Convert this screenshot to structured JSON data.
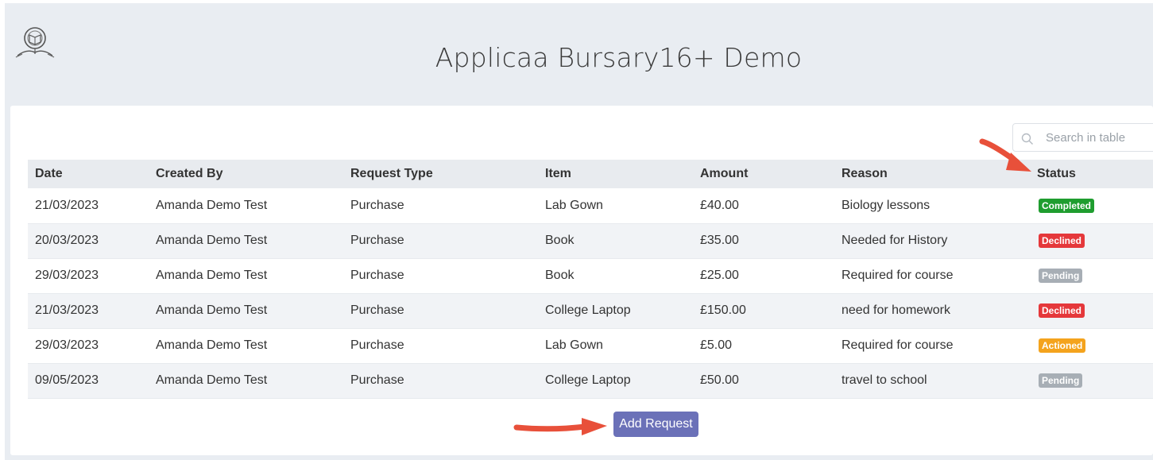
{
  "app": {
    "title": "Applicaa Bursary16+ Demo"
  },
  "search": {
    "placeholder": "Search in table"
  },
  "table": {
    "columns": [
      "Date",
      "Created By",
      "Request Type",
      "Item",
      "Amount",
      "Reason",
      "Status"
    ],
    "rows": [
      {
        "date": "21/03/2023",
        "created_by": "Amanda Demo Test",
        "request_type": "Purchase",
        "item": "Lab Gown",
        "amount": "£40.00",
        "reason": "Biology lessons",
        "status": "Completed"
      },
      {
        "date": "20/03/2023",
        "created_by": "Amanda Demo Test",
        "request_type": "Purchase",
        "item": "Book",
        "amount": "£35.00",
        "reason": "Needed for History",
        "status": "Declined"
      },
      {
        "date": "29/03/2023",
        "created_by": "Amanda Demo Test",
        "request_type": "Purchase",
        "item": "Book",
        "amount": "£25.00",
        "reason": "Required for course",
        "status": "Pending"
      },
      {
        "date": "21/03/2023",
        "created_by": "Amanda Demo Test",
        "request_type": "Purchase",
        "item": "College Laptop",
        "amount": "£150.00",
        "reason": "need for homework",
        "status": "Declined"
      },
      {
        "date": "29/03/2023",
        "created_by": "Amanda Demo Test",
        "request_type": "Purchase",
        "item": "Lab Gown",
        "amount": "£5.00",
        "reason": "Required for course",
        "status": "Actioned"
      },
      {
        "date": "09/05/2023",
        "created_by": "Amanda Demo Test",
        "request_type": "Purchase",
        "item": "College Laptop",
        "amount": "£50.00",
        "reason": "travel to school",
        "status": "Pending"
      }
    ]
  },
  "status_colors": {
    "Completed": "#1f9d2f",
    "Declined": "#e5383b",
    "Pending": "#a7aeb5",
    "Actioned": "#f4a31d"
  },
  "actions": {
    "add_request_label": "Add Request"
  },
  "annotations": {
    "arrow_color": "#e8503a"
  },
  "icons": {
    "logo": "owl-book-crest-icon",
    "search": "search-icon",
    "annotation": "arrow-icon"
  }
}
